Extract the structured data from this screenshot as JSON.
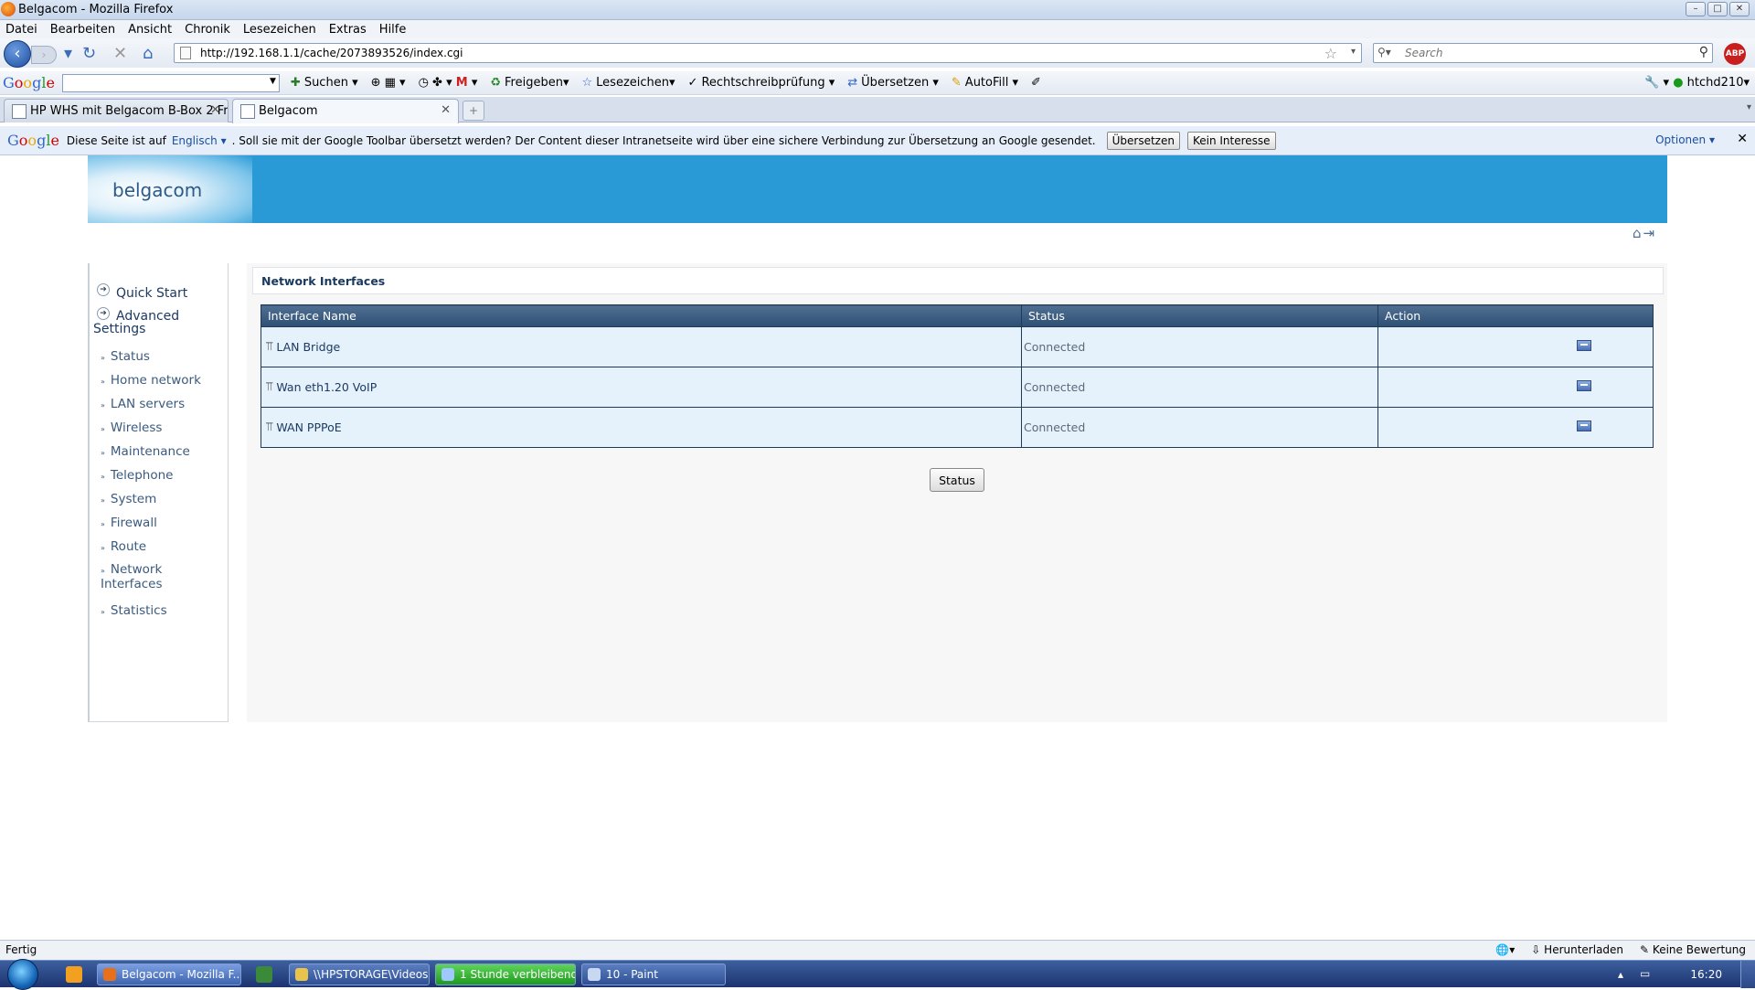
{
  "window": {
    "title": "Belgacom - Mozilla Firefox"
  },
  "menubar": [
    "Datei",
    "Bearbeiten",
    "Ansicht",
    "Chronik",
    "Lesezeichen",
    "Extras",
    "Hilfe"
  ],
  "navbar": {
    "url": "http://192.168.1.1/cache/2073893526/index.cgi",
    "search_placeholder": "Search"
  },
  "google_toolbar": {
    "logo": "Google",
    "items": [
      "Suchen",
      "Freigeben",
      "Lesezeichen",
      "Rechtschreibprüfung",
      "Übersetzen",
      "AutoFill"
    ],
    "account": "htchd210"
  },
  "tabs": [
    {
      "label": "HP WHS mit Belgacom B-Box 2 Fra..."
    },
    {
      "label": "Belgacom"
    }
  ],
  "translate_bar": {
    "prefix": "Diese Seite ist auf",
    "language": "Englisch",
    "message": ". Soll sie mit der Google Toolbar übersetzt werden? Der Content dieser Intranetseite wird über eine sichere Verbindung zur Übersetzung an Google gesendet.",
    "translate_button": "Übersetzen",
    "decline_button": "Kein Interesse",
    "options": "Optionen"
  },
  "banner": {
    "logo": "belgacom"
  },
  "sidebar": {
    "main": [
      {
        "label": "Quick Start"
      },
      {
        "label": "Advanced Settings"
      }
    ],
    "sub": [
      "Status",
      "Home network",
      "LAN servers",
      "Wireless",
      "Maintenance",
      "Telephone",
      "System",
      "Firewall",
      "Route",
      "Network Interfaces",
      "Statistics"
    ]
  },
  "content": {
    "title": "Network Interfaces",
    "columns": [
      "Interface Name",
      "Status",
      "Action"
    ],
    "rows": [
      {
        "name": "LAN Bridge",
        "status": "Connected"
      },
      {
        "name": "Wan eth1.20 VoIP",
        "status": "Connected"
      },
      {
        "name": "WAN PPPoE",
        "status": "Connected"
      }
    ],
    "status_button": "Status"
  },
  "statusbar": {
    "left": "Fertig",
    "download": "Herunterladen",
    "rating": "Keine Bewertung"
  },
  "taskbar": {
    "items": [
      {
        "label": "Belgacom - Mozilla F..."
      },
      {
        "label": "\\\\HPSTORAGE\\Videos"
      },
      {
        "label": "1 Stunde verbleibend"
      },
      {
        "label": "10 - Paint"
      }
    ],
    "clock": "16:20"
  }
}
